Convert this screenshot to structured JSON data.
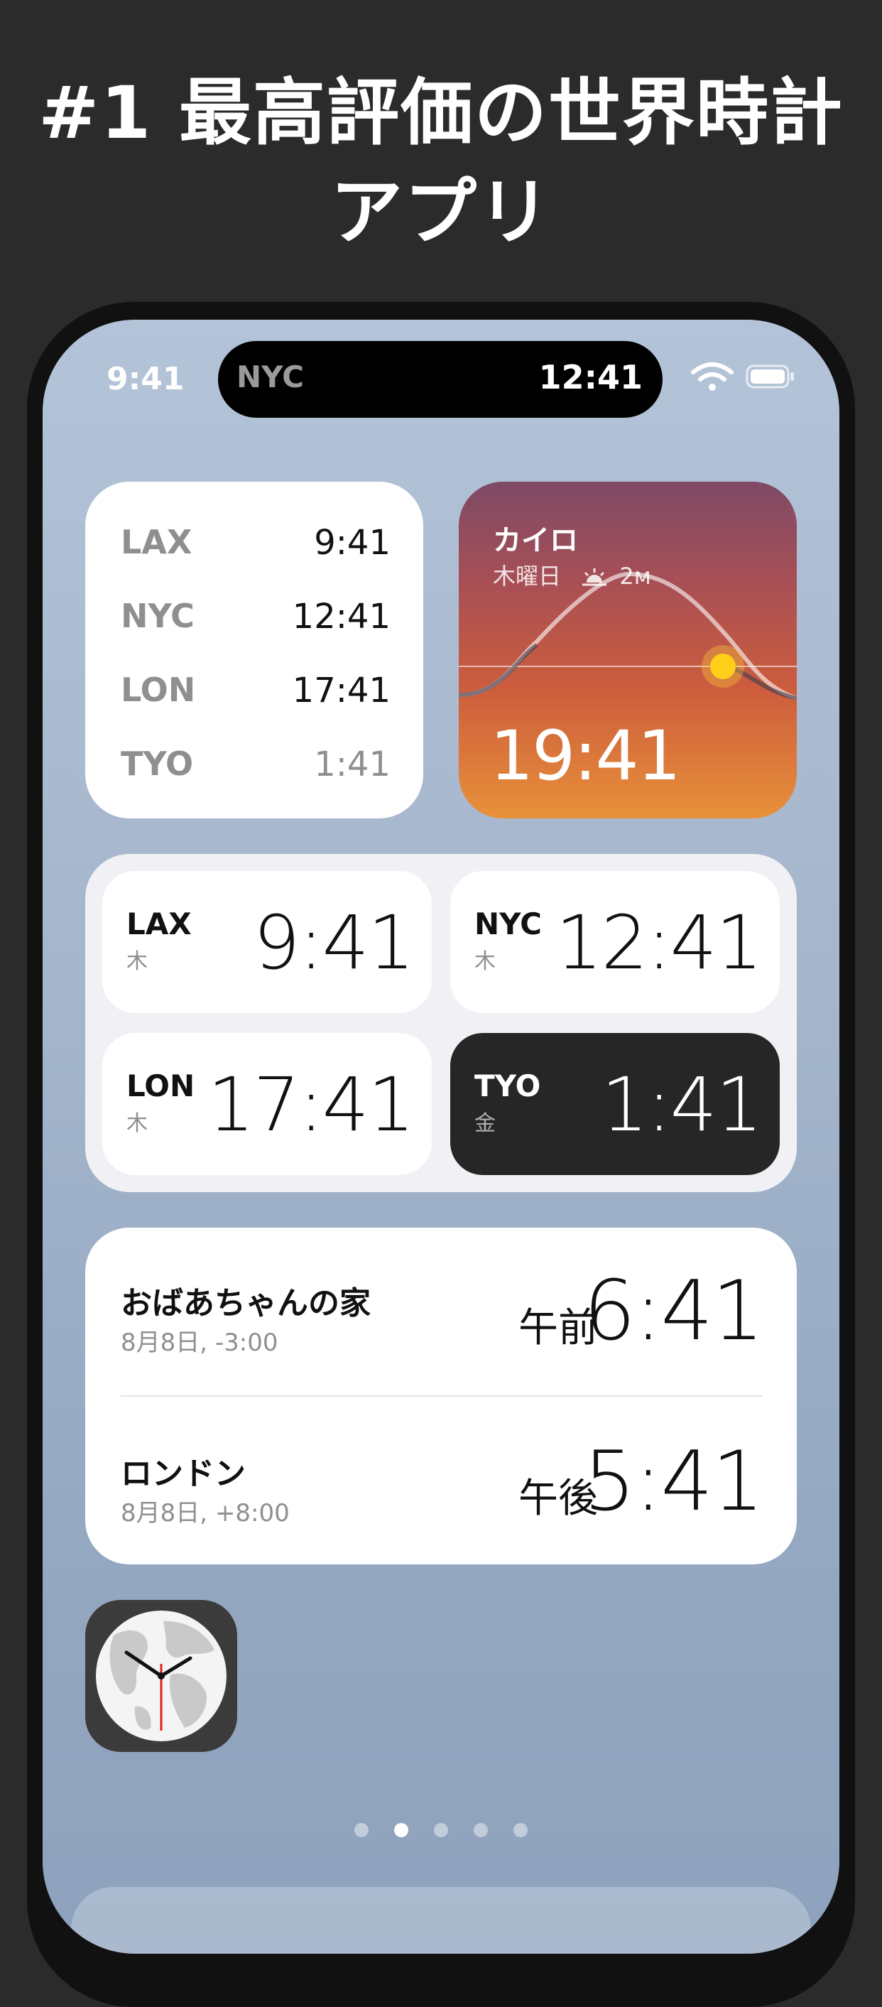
{
  "headline": {
    "line1": "#1 最高評価の世界時計",
    "line2": "アプリ"
  },
  "status_bar": {
    "time": "9:41",
    "island_city": "NYC",
    "island_time": "12:41",
    "wifi_icon": "wifi-icon",
    "battery_icon": "battery-icon"
  },
  "widget_list": {
    "rows": [
      {
        "city": "LAX",
        "time": "9:41"
      },
      {
        "city": "NYC",
        "time": "12:41"
      },
      {
        "city": "LON",
        "time": "17:41"
      },
      {
        "city": "TYO",
        "time": "1:41"
      }
    ]
  },
  "widget_sun": {
    "city": "カイロ",
    "day": "木曜日",
    "sunrise_icon": "sunrise-icon",
    "duration": "2м",
    "time": "19:41",
    "colors": {
      "top": "#7e4a66",
      "bottom": "#e8913a",
      "sun": "#ffcf1a"
    }
  },
  "widget_grid": {
    "tiles": [
      {
        "city": "LAX",
        "day": "木",
        "time": "9:41"
      },
      {
        "city": "NYC",
        "day": "木",
        "time": "12:41"
      },
      {
        "city": "LON",
        "day": "木",
        "time": "17:41"
      },
      {
        "city": "TYO",
        "day": "金",
        "time": "1:41"
      }
    ]
  },
  "widget_zones": {
    "zones": [
      {
        "name": "おばあちゃんの家",
        "sub": "8月8日, -3:00",
        "ampm": "午前",
        "time": "6:41"
      },
      {
        "name": "ロンドン",
        "sub": "8月8日, +8:00",
        "ampm": "午後",
        "time": "5:41"
      }
    ]
  },
  "app_icon": {
    "icon": "world-clock-icon",
    "accent": "#e0201a"
  },
  "page_dots": {
    "count": 5,
    "active_index": 1
  }
}
